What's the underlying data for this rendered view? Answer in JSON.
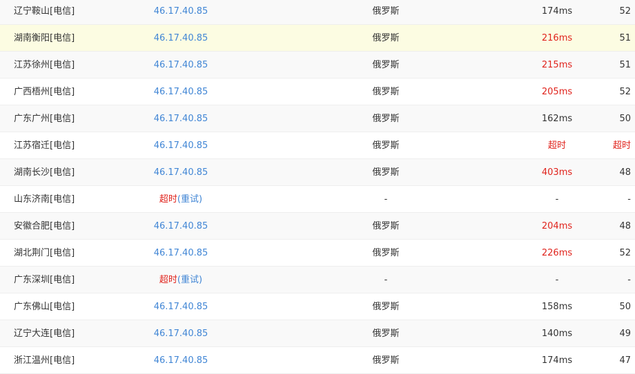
{
  "rows": [
    {
      "location": "辽宁鞍山[电信]",
      "ip": "46.17.40.85",
      "geo": "俄罗斯",
      "ms": "174ms",
      "ms_red": false,
      "ttl": "52",
      "ttl_red": false,
      "highlight": false
    },
    {
      "location": "湖南衡阳[电信]",
      "ip": "46.17.40.85",
      "geo": "俄罗斯",
      "ms": "216ms",
      "ms_red": true,
      "ttl": "51",
      "ttl_red": false,
      "highlight": true
    },
    {
      "location": "江苏徐州[电信]",
      "ip": "46.17.40.85",
      "geo": "俄罗斯",
      "ms": "215ms",
      "ms_red": true,
      "ttl": "51",
      "ttl_red": false,
      "highlight": false
    },
    {
      "location": "广西梧州[电信]",
      "ip": "46.17.40.85",
      "geo": "俄罗斯",
      "ms": "205ms",
      "ms_red": true,
      "ttl": "52",
      "ttl_red": false,
      "highlight": false
    },
    {
      "location": "广东广州[电信]",
      "ip": "46.17.40.85",
      "geo": "俄罗斯",
      "ms": "162ms",
      "ms_red": false,
      "ttl": "50",
      "ttl_red": false,
      "highlight": false
    },
    {
      "location": "江苏宿迁[电信]",
      "ip": "46.17.40.85",
      "geo": "俄罗斯",
      "ms": "超时",
      "ms_red": true,
      "ttl": "超时",
      "ttl_red": true,
      "highlight": false
    },
    {
      "location": "湖南长沙[电信]",
      "ip": "46.17.40.85",
      "geo": "俄罗斯",
      "ms": "403ms",
      "ms_red": true,
      "ttl": "48",
      "ttl_red": false,
      "highlight": false
    },
    {
      "location": "山东济南[电信]",
      "ip_timeout": "超时",
      "ip_retry": "(重试)",
      "geo": "-",
      "ms": "-",
      "ms_red": false,
      "ttl": "-",
      "ttl_red": false,
      "highlight": false
    },
    {
      "location": "安徽合肥[电信]",
      "ip": "46.17.40.85",
      "geo": "俄罗斯",
      "ms": "204ms",
      "ms_red": true,
      "ttl": "48",
      "ttl_red": false,
      "highlight": false
    },
    {
      "location": "湖北荆门[电信]",
      "ip": "46.17.40.85",
      "geo": "俄罗斯",
      "ms": "226ms",
      "ms_red": true,
      "ttl": "52",
      "ttl_red": false,
      "highlight": false
    },
    {
      "location": "广东深圳[电信]",
      "ip_timeout": "超时",
      "ip_retry": "(重试)",
      "geo": "-",
      "ms": "-",
      "ms_red": false,
      "ttl": "-",
      "ttl_red": false,
      "highlight": false
    },
    {
      "location": "广东佛山[电信]",
      "ip": "46.17.40.85",
      "geo": "俄罗斯",
      "ms": "158ms",
      "ms_red": false,
      "ttl": "50",
      "ttl_red": false,
      "highlight": false
    },
    {
      "location": "辽宁大连[电信]",
      "ip": "46.17.40.85",
      "geo": "俄罗斯",
      "ms": "140ms",
      "ms_red": false,
      "ttl": "49",
      "ttl_red": false,
      "highlight": false
    },
    {
      "location": "浙江温州[电信]",
      "ip": "46.17.40.85",
      "geo": "俄罗斯",
      "ms": "174ms",
      "ms_red": false,
      "ttl": "47",
      "ttl_red": false,
      "highlight": false
    }
  ],
  "colors": {
    "link_blue": "#4186d5",
    "timeout_red": "#e0231c",
    "highlight_row": "#fcfce2",
    "stripe_row": "#f9f9f9"
  }
}
